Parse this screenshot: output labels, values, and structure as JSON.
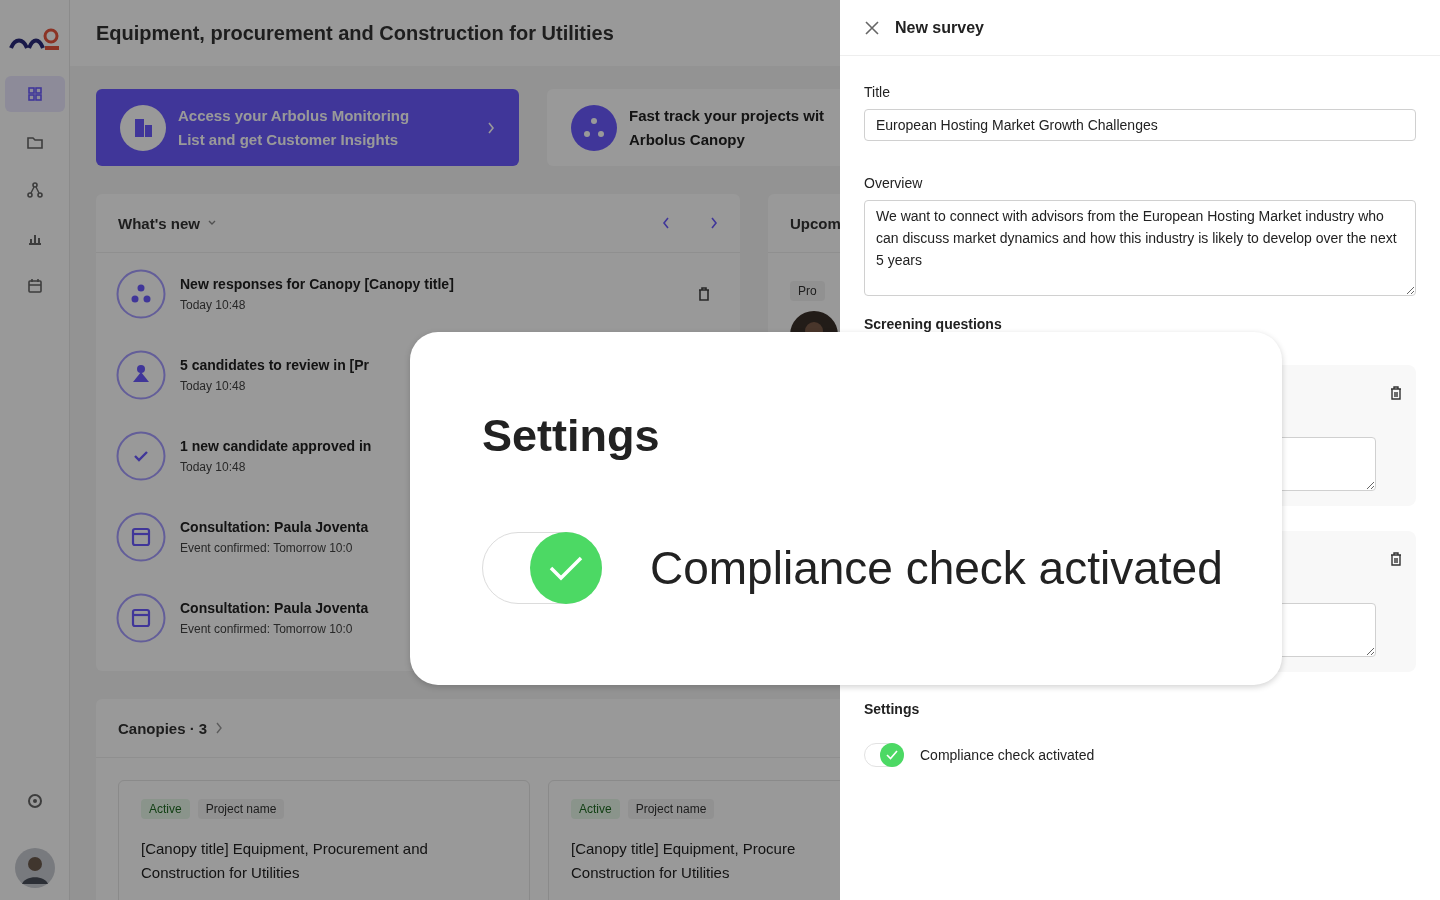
{
  "app": {
    "page_title": "Equipment, procurement and Construction for Utilities",
    "nav": [
      {
        "kind": "grid",
        "selected": true
      },
      {
        "kind": "folder",
        "selected": false
      },
      {
        "kind": "network",
        "selected": false
      },
      {
        "kind": "chart",
        "selected": false
      },
      {
        "kind": "calendar",
        "selected": false
      }
    ],
    "banners": [
      {
        "kind": "primary",
        "text": "Access your Arbolus Monitoring\nList and get Customer Insights"
      },
      {
        "kind": "secondary",
        "text": "Fast track your projects wit\nArbolus Canopy"
      }
    ],
    "whats_new": {
      "title": "What's new",
      "items": [
        {
          "kind": "canopy",
          "title": "New responses for Canopy [Canopy title]",
          "time": "Today 10:48",
          "deletable": true
        },
        {
          "kind": "people",
          "title": "5 candidates to review in [Pr",
          "time": "Today 10:48",
          "deletable": false
        },
        {
          "kind": "check",
          "title": "1 new candidate approved in",
          "time": "Today 10:48",
          "deletable": false
        },
        {
          "kind": "calendar",
          "title": "Consultation: Paula Joventa",
          "time": "Event confirmed: Tomorrow 10:0",
          "deletable": false
        },
        {
          "kind": "calendar",
          "title": "Consultation: Paula Joventa",
          "time": "Event confirmed: Tomorrow 10:0",
          "deletable": false
        }
      ]
    },
    "upcoming": {
      "title": "Upcom",
      "tag": "Pro"
    },
    "canopies": {
      "title": "Canopies · 3",
      "cards": [
        {
          "status": "Active",
          "project": "Project name",
          "title": "[Canopy title] Equipment, Procurement and\nConstruction for Utilities"
        },
        {
          "status": "Active",
          "project": "Project name",
          "title": "[Canopy title] Equipment, Procure\nConstruction for Utilities"
        }
      ]
    }
  },
  "panel": {
    "title": "New survey",
    "fields": [
      {
        "kind": "input",
        "label": "Title",
        "value": "European Hosting Market Growth Challenges"
      },
      {
        "kind": "textarea",
        "label": "Overview",
        "value": "We want to connect with advisors from the European Hosting Market industry who can discuss market dynamics and how this industry is likely to develop over the next 5 years"
      }
    ],
    "screening": {
      "title": "Screening questions",
      "questions": [
        {
          "kind": "free_text"
        },
        {
          "kind": "free_text"
        }
      ]
    },
    "settings": {
      "title": "Settings",
      "toggles": [
        {
          "label": "Compliance check activated",
          "on": true
        }
      ]
    }
  },
  "callout": {
    "title": "Settings",
    "toggle": {
      "label": "Compliance check activated",
      "on": true
    }
  }
}
